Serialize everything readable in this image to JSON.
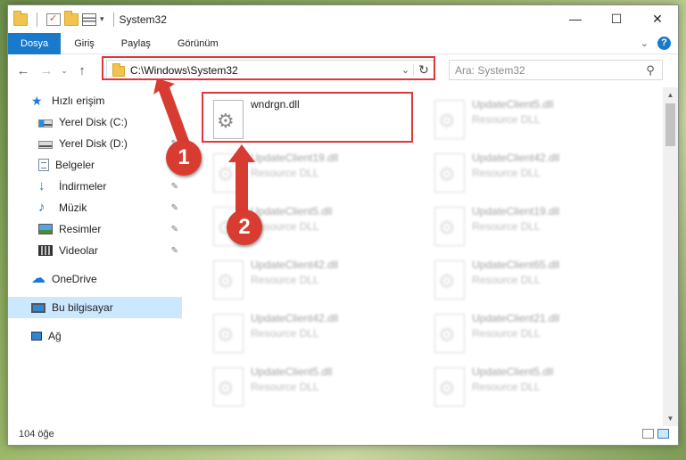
{
  "window": {
    "title": "System32"
  },
  "titlebar": {
    "minimize": "—",
    "maximize": "☐",
    "close": "✕"
  },
  "ribbon": {
    "tabs": [
      "Dosya",
      "Giriş",
      "Paylaş",
      "Görünüm"
    ],
    "help": "?"
  },
  "nav": {
    "back": "←",
    "forward": "→",
    "recent": "⌄",
    "up": "↑",
    "address": "C:\\Windows\\System32",
    "address_dropdown": "⌄",
    "refresh": "↻",
    "search_placeholder": "Ara: System32",
    "search_icon": "⚲"
  },
  "sidebar": {
    "quick_access": "Hızlı erişim",
    "items": [
      {
        "label": "Yerel Disk (C:)",
        "icon": "drive-windows-icon",
        "pinned": true
      },
      {
        "label": "Yerel Disk (D:)",
        "icon": "drive-icon",
        "pinned": true
      },
      {
        "label": "Belgeler",
        "icon": "documents-icon",
        "pinned": true
      },
      {
        "label": "İndirmeler",
        "icon": "downloads-icon",
        "pinned": true
      },
      {
        "label": "Müzik",
        "icon": "music-icon",
        "pinned": true
      },
      {
        "label": "Resimler",
        "icon": "pictures-icon",
        "pinned": true
      },
      {
        "label": "Videolar",
        "icon": "videos-icon",
        "pinned": true
      }
    ],
    "onedrive": "OneDrive",
    "this_pc": "Bu bilgisayar",
    "network": "Ağ",
    "pin_glyph": "📌"
  },
  "files": [
    {
      "name": "wndrgn.dll",
      "type": "",
      "highlighted": true
    },
    {
      "name": "UpdateClient5.dll",
      "type": "Resource DLL"
    },
    {
      "name": "UpdateClient19.dll",
      "type": "Resource DLL"
    },
    {
      "name": "UpdateClient42.dll",
      "type": "Resource DLL"
    },
    {
      "name": "UpdateClient5.dll",
      "type": "Resource DLL"
    },
    {
      "name": "UpdateClient19.dll",
      "type": "Resource DLL"
    },
    {
      "name": "UpdateClient42.dll",
      "type": "Resource DLL"
    },
    {
      "name": "UpdateClient65.dll",
      "type": "Resource DLL"
    },
    {
      "name": "UpdateClient42.dll",
      "type": "Resource DLL"
    },
    {
      "name": "UpdateClient21.dll",
      "type": "Resource DLL"
    },
    {
      "name": "UpdateClient5.dll",
      "type": "Resource DLL"
    },
    {
      "name": "UpdateClient5.dll",
      "type": "Resource DLL"
    }
  ],
  "status": {
    "count": "104 öğe"
  },
  "annotations": {
    "step1": "1",
    "step2": "2",
    "color": "#d83b30"
  },
  "scroll": {
    "up": "▲",
    "down": "▼"
  }
}
